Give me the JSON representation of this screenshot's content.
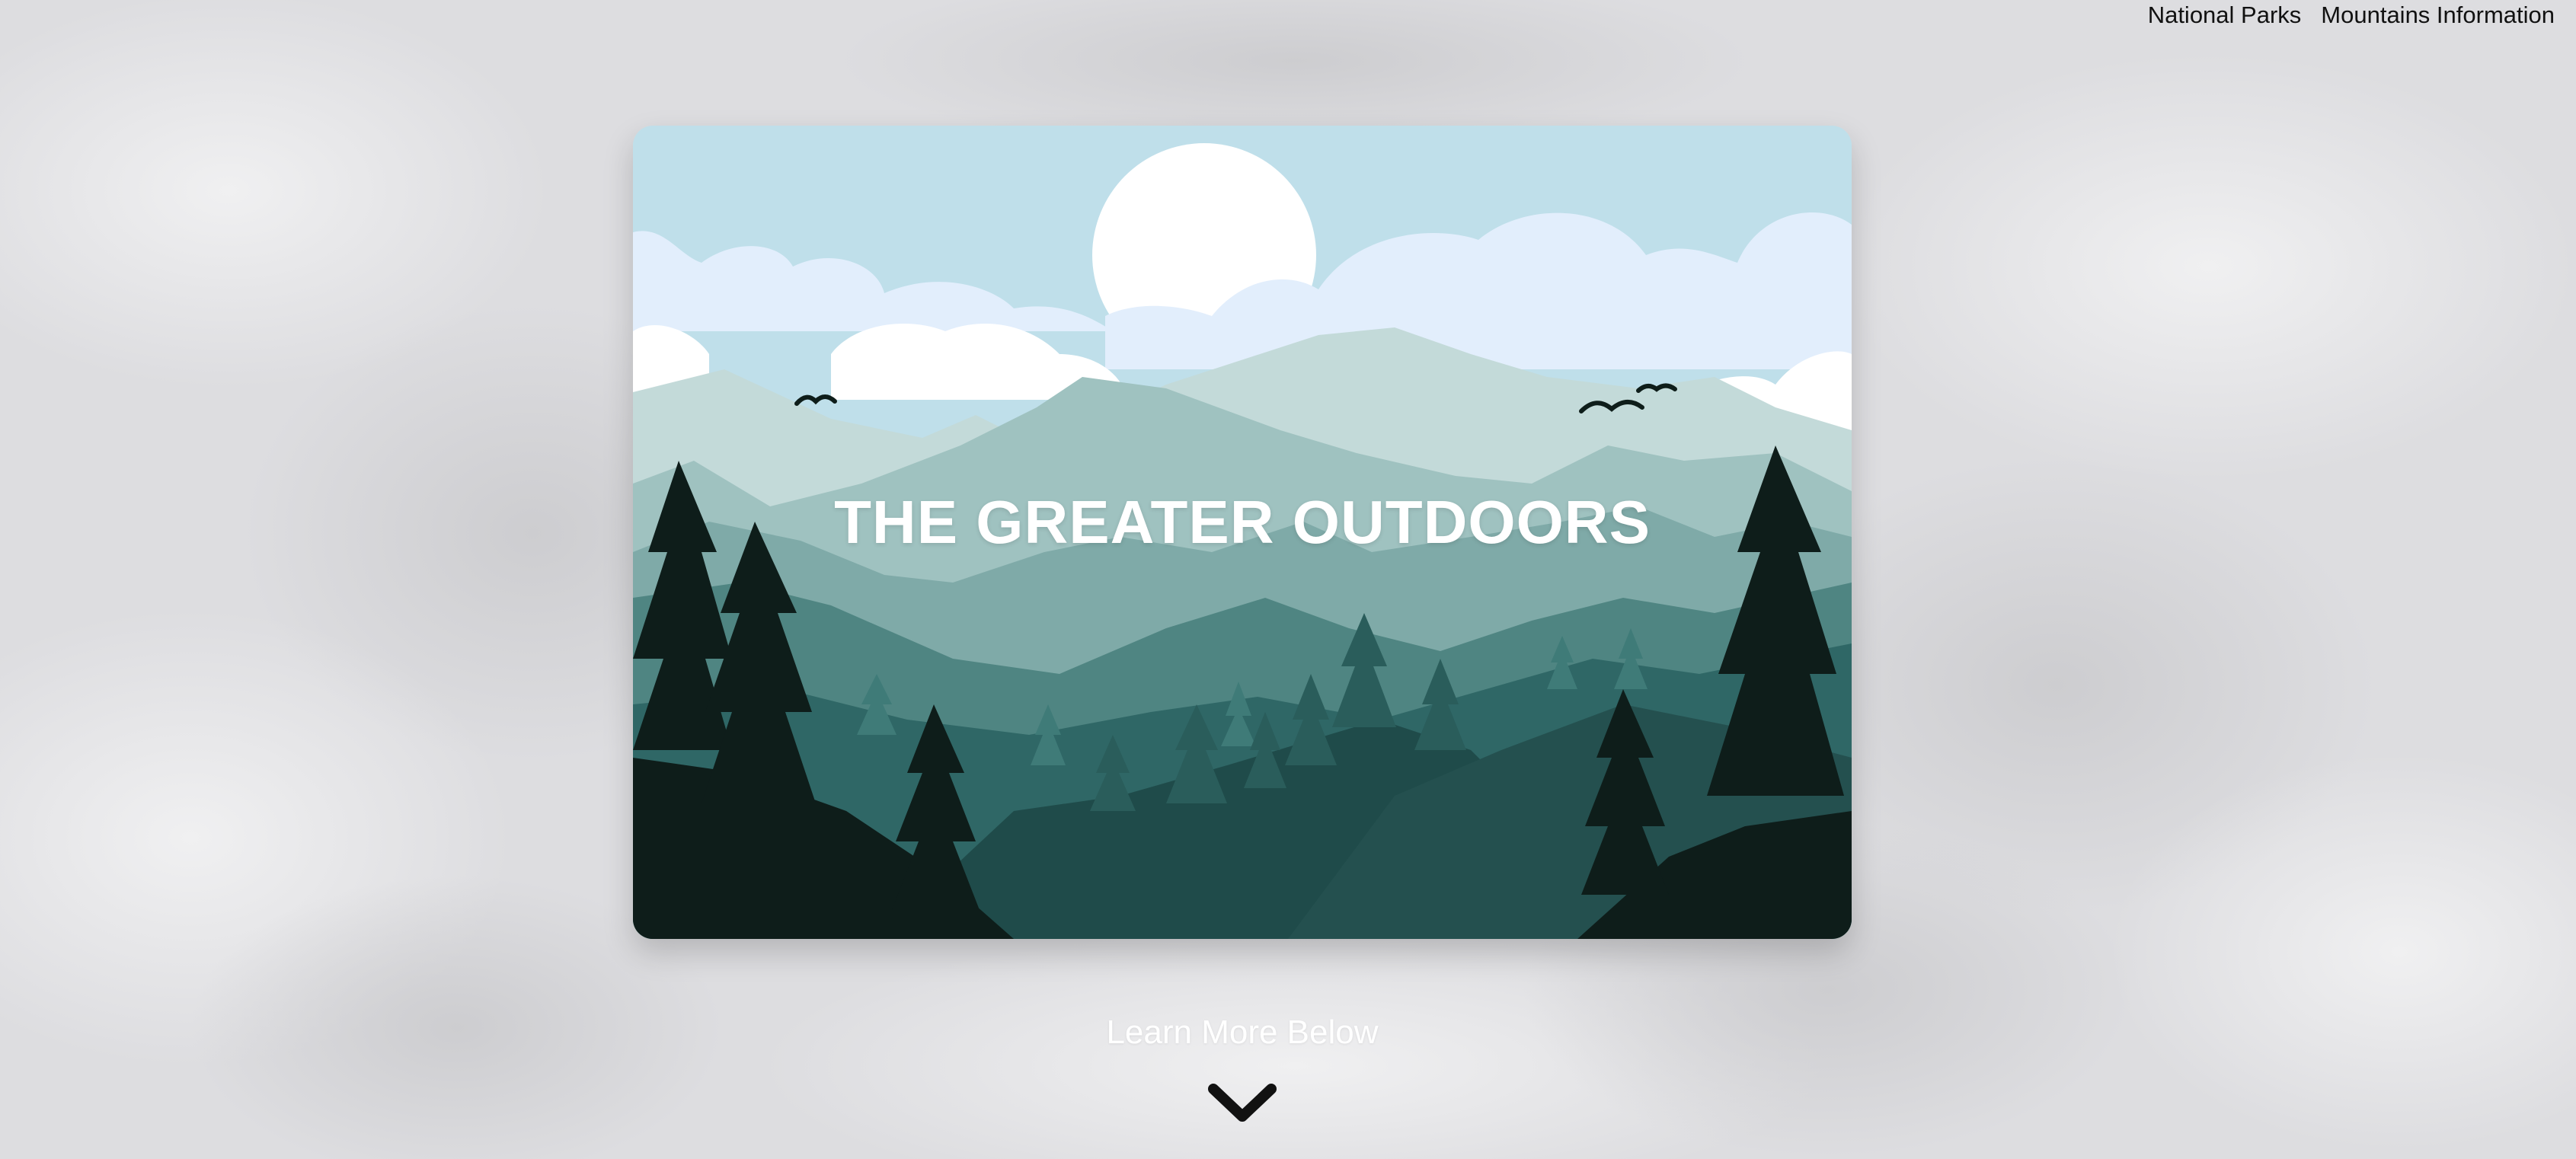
{
  "nav": {
    "items": [
      {
        "label": "National Parks"
      },
      {
        "label": "Mountains Information"
      }
    ]
  },
  "hero": {
    "title": "THE GREATER OUTDOORS"
  },
  "scroll_hint": {
    "label": "Learn More Below",
    "icon": "chevron-down-icon"
  },
  "colors": {
    "page_background": "#dcdcde",
    "sky": "#bfdfea",
    "clouds": "#e2eefc",
    "sun": "#ffffff",
    "far_mountains": "#c3dad9",
    "mid_mountains": "#8fb5b3",
    "near_hills": "#2b5c5c",
    "foreground_trees": "#0e1d1a",
    "title_text": "#ffffff",
    "nav_text": "#111111"
  }
}
